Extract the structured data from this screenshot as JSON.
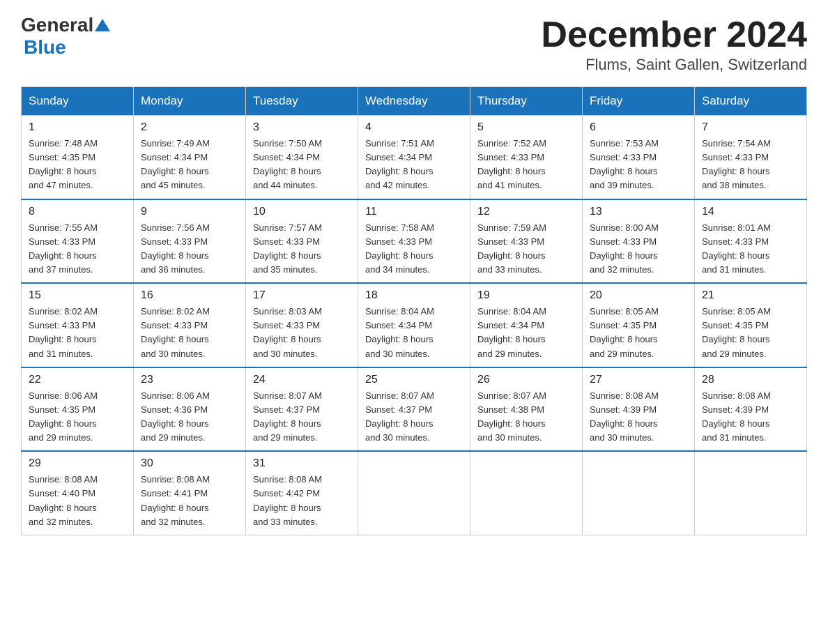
{
  "logo": {
    "text_general": "General",
    "text_blue": "Blue",
    "line2": "Blue"
  },
  "header": {
    "month": "December 2024",
    "location": "Flums, Saint Gallen, Switzerland"
  },
  "weekdays": [
    "Sunday",
    "Monday",
    "Tuesday",
    "Wednesday",
    "Thursday",
    "Friday",
    "Saturday"
  ],
  "weeks": [
    [
      {
        "day": "1",
        "sunrise": "7:48 AM",
        "sunset": "4:35 PM",
        "daylight": "8 hours and 47 minutes."
      },
      {
        "day": "2",
        "sunrise": "7:49 AM",
        "sunset": "4:34 PM",
        "daylight": "8 hours and 45 minutes."
      },
      {
        "day": "3",
        "sunrise": "7:50 AM",
        "sunset": "4:34 PM",
        "daylight": "8 hours and 44 minutes."
      },
      {
        "day": "4",
        "sunrise": "7:51 AM",
        "sunset": "4:34 PM",
        "daylight": "8 hours and 42 minutes."
      },
      {
        "day": "5",
        "sunrise": "7:52 AM",
        "sunset": "4:33 PM",
        "daylight": "8 hours and 41 minutes."
      },
      {
        "day": "6",
        "sunrise": "7:53 AM",
        "sunset": "4:33 PM",
        "daylight": "8 hours and 39 minutes."
      },
      {
        "day": "7",
        "sunrise": "7:54 AM",
        "sunset": "4:33 PM",
        "daylight": "8 hours and 38 minutes."
      }
    ],
    [
      {
        "day": "8",
        "sunrise": "7:55 AM",
        "sunset": "4:33 PM",
        "daylight": "8 hours and 37 minutes."
      },
      {
        "day": "9",
        "sunrise": "7:56 AM",
        "sunset": "4:33 PM",
        "daylight": "8 hours and 36 minutes."
      },
      {
        "day": "10",
        "sunrise": "7:57 AM",
        "sunset": "4:33 PM",
        "daylight": "8 hours and 35 minutes."
      },
      {
        "day": "11",
        "sunrise": "7:58 AM",
        "sunset": "4:33 PM",
        "daylight": "8 hours and 34 minutes."
      },
      {
        "day": "12",
        "sunrise": "7:59 AM",
        "sunset": "4:33 PM",
        "daylight": "8 hours and 33 minutes."
      },
      {
        "day": "13",
        "sunrise": "8:00 AM",
        "sunset": "4:33 PM",
        "daylight": "8 hours and 32 minutes."
      },
      {
        "day": "14",
        "sunrise": "8:01 AM",
        "sunset": "4:33 PM",
        "daylight": "8 hours and 31 minutes."
      }
    ],
    [
      {
        "day": "15",
        "sunrise": "8:02 AM",
        "sunset": "4:33 PM",
        "daylight": "8 hours and 31 minutes."
      },
      {
        "day": "16",
        "sunrise": "8:02 AM",
        "sunset": "4:33 PM",
        "daylight": "8 hours and 30 minutes."
      },
      {
        "day": "17",
        "sunrise": "8:03 AM",
        "sunset": "4:33 PM",
        "daylight": "8 hours and 30 minutes."
      },
      {
        "day": "18",
        "sunrise": "8:04 AM",
        "sunset": "4:34 PM",
        "daylight": "8 hours and 30 minutes."
      },
      {
        "day": "19",
        "sunrise": "8:04 AM",
        "sunset": "4:34 PM",
        "daylight": "8 hours and 29 minutes."
      },
      {
        "day": "20",
        "sunrise": "8:05 AM",
        "sunset": "4:35 PM",
        "daylight": "8 hours and 29 minutes."
      },
      {
        "day": "21",
        "sunrise": "8:05 AM",
        "sunset": "4:35 PM",
        "daylight": "8 hours and 29 minutes."
      }
    ],
    [
      {
        "day": "22",
        "sunrise": "8:06 AM",
        "sunset": "4:35 PM",
        "daylight": "8 hours and 29 minutes."
      },
      {
        "day": "23",
        "sunrise": "8:06 AM",
        "sunset": "4:36 PM",
        "daylight": "8 hours and 29 minutes."
      },
      {
        "day": "24",
        "sunrise": "8:07 AM",
        "sunset": "4:37 PM",
        "daylight": "8 hours and 29 minutes."
      },
      {
        "day": "25",
        "sunrise": "8:07 AM",
        "sunset": "4:37 PM",
        "daylight": "8 hours and 30 minutes."
      },
      {
        "day": "26",
        "sunrise": "8:07 AM",
        "sunset": "4:38 PM",
        "daylight": "8 hours and 30 minutes."
      },
      {
        "day": "27",
        "sunrise": "8:08 AM",
        "sunset": "4:39 PM",
        "daylight": "8 hours and 30 minutes."
      },
      {
        "day": "28",
        "sunrise": "8:08 AM",
        "sunset": "4:39 PM",
        "daylight": "8 hours and 31 minutes."
      }
    ],
    [
      {
        "day": "29",
        "sunrise": "8:08 AM",
        "sunset": "4:40 PM",
        "daylight": "8 hours and 32 minutes."
      },
      {
        "day": "30",
        "sunrise": "8:08 AM",
        "sunset": "4:41 PM",
        "daylight": "8 hours and 32 minutes."
      },
      {
        "day": "31",
        "sunrise": "8:08 AM",
        "sunset": "4:42 PM",
        "daylight": "8 hours and 33 minutes."
      },
      null,
      null,
      null,
      null
    ]
  ],
  "labels": {
    "sunrise": "Sunrise: ",
    "sunset": "Sunset: ",
    "daylight": "Daylight: "
  }
}
